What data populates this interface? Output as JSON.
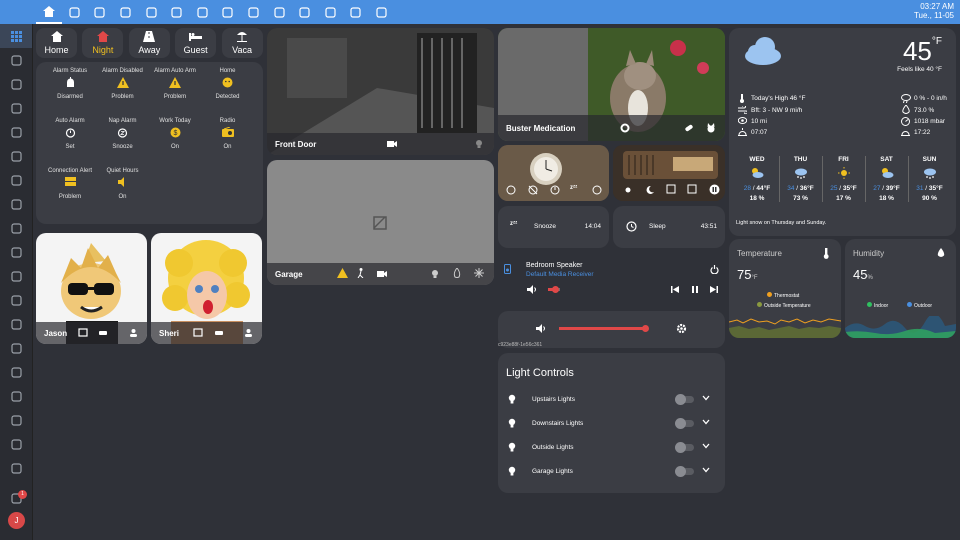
{
  "topbar": {
    "time": "03:27 AM",
    "date": "Tue., 11-05",
    "tabs": [
      "home-icon",
      "weather-sun-icon",
      "people-icon",
      "calendar-icon",
      "thermometer-icon",
      "light-bulb-icon",
      "garage-icon",
      "washer-icon",
      "camera-icon",
      "car-icon",
      "vacuum-icon",
      "bug-icon",
      "router-icon",
      "printer-icon"
    ]
  },
  "sidebar": {
    "items": [
      "grid-icon",
      "map-icon",
      "logbook-icon",
      "history-icon",
      "shield-icon",
      "braces-icon",
      "tools-icon",
      "gauge-icon",
      "box-icon",
      "list-icon",
      "code-icon",
      "network-icon",
      "fish-icon",
      "cloud-icon",
      "terminal-icon",
      "chip-icon",
      "hammer-icon",
      "puzzle-icon",
      "gear-icon",
      "bell-icon",
      "avatar-icon"
    ],
    "notification_count": "1",
    "avatar_letter": "J"
  },
  "modes": [
    {
      "label": "Home",
      "icon": "home-icon"
    },
    {
      "label": "Night",
      "icon": "home-night-icon",
      "color": "#f0c020"
    },
    {
      "label": "Away",
      "icon": "road-icon"
    },
    {
      "label": "Guest",
      "icon": "bed-icon"
    },
    {
      "label": "Vaca",
      "icon": "beach-icon"
    }
  ],
  "alarm": {
    "row1_labels": [
      "Alarm Status",
      "Alarm Disabled",
      "Alarm Auto Arm",
      "Home"
    ],
    "row1_values": [
      "Disarmed",
      "Problem",
      "Problem",
      "Detected"
    ],
    "row2_labels": [
      "Auto Alarm",
      "Nap Alarm",
      "Work Today",
      "Radio"
    ],
    "row2_values": [
      "Set",
      "Snooze",
      "On",
      "On"
    ],
    "row3_labels": [
      "Connection Alert",
      "Quiet Hours"
    ],
    "row3_values": [
      "Problem",
      "On"
    ]
  },
  "cameras": {
    "front_door": "Front Door",
    "garage": "Garage"
  },
  "people": [
    {
      "name": "Jason"
    },
    {
      "name": "Sheri"
    }
  ],
  "buster": {
    "label": "Buster Medication"
  },
  "snooze": {
    "label": "Snooze",
    "time": "14:04"
  },
  "sleep": {
    "label": "Sleep",
    "time": "43:51"
  },
  "media": {
    "title": "Bedroom Speaker",
    "subtitle": "Default Media Receiver",
    "volume_level": 0.6,
    "id": "c923e88f-1e56c361"
  },
  "lights": {
    "title": "Light Controls",
    "items": [
      "Upstairs Lights",
      "Downstairs Lights",
      "Outside Lights",
      "Garage Lights"
    ]
  },
  "weather": {
    "temp": "45",
    "unit": "°F",
    "feels_like": "Feels like 40 °F",
    "high": "Today's High 46 °F",
    "wind": "Bft: 3 - NW 9 mi/h",
    "visibility": "10 mi",
    "sunrise": "07:07",
    "precip": "0 % - 0 in/h",
    "humidity": "73.0 %",
    "pressure": "1018 mbar",
    "sunset": "17:22",
    "forecast": [
      {
        "day": "WED",
        "lo": "28",
        "hi": "44°F",
        "pct": "18 %"
      },
      {
        "day": "THU",
        "lo": "34",
        "hi": "36°F",
        "pct": "73 %"
      },
      {
        "day": "FRI",
        "lo": "25",
        "hi": "35°F",
        "pct": "17 %"
      },
      {
        "day": "SAT",
        "lo": "27",
        "hi": "39°F",
        "pct": "18 %"
      },
      {
        "day": "SUN",
        "lo": "31",
        "hi": "35°F",
        "pct": "90 %"
      }
    ],
    "summary": "Light snow on Thursday and Sunday."
  },
  "temperature": {
    "title": "Temperature",
    "value": "75",
    "unit": "°F",
    "legend": [
      "Thermostat",
      "Outside Temperature"
    ]
  },
  "humidity": {
    "title": "Humidity",
    "value": "45",
    "unit": "%",
    "legend": [
      "Indoor",
      "Outdoor"
    ]
  },
  "colors": {
    "accent": "#4a8fe0",
    "warn": "#f0c020",
    "red": "#e04848"
  }
}
